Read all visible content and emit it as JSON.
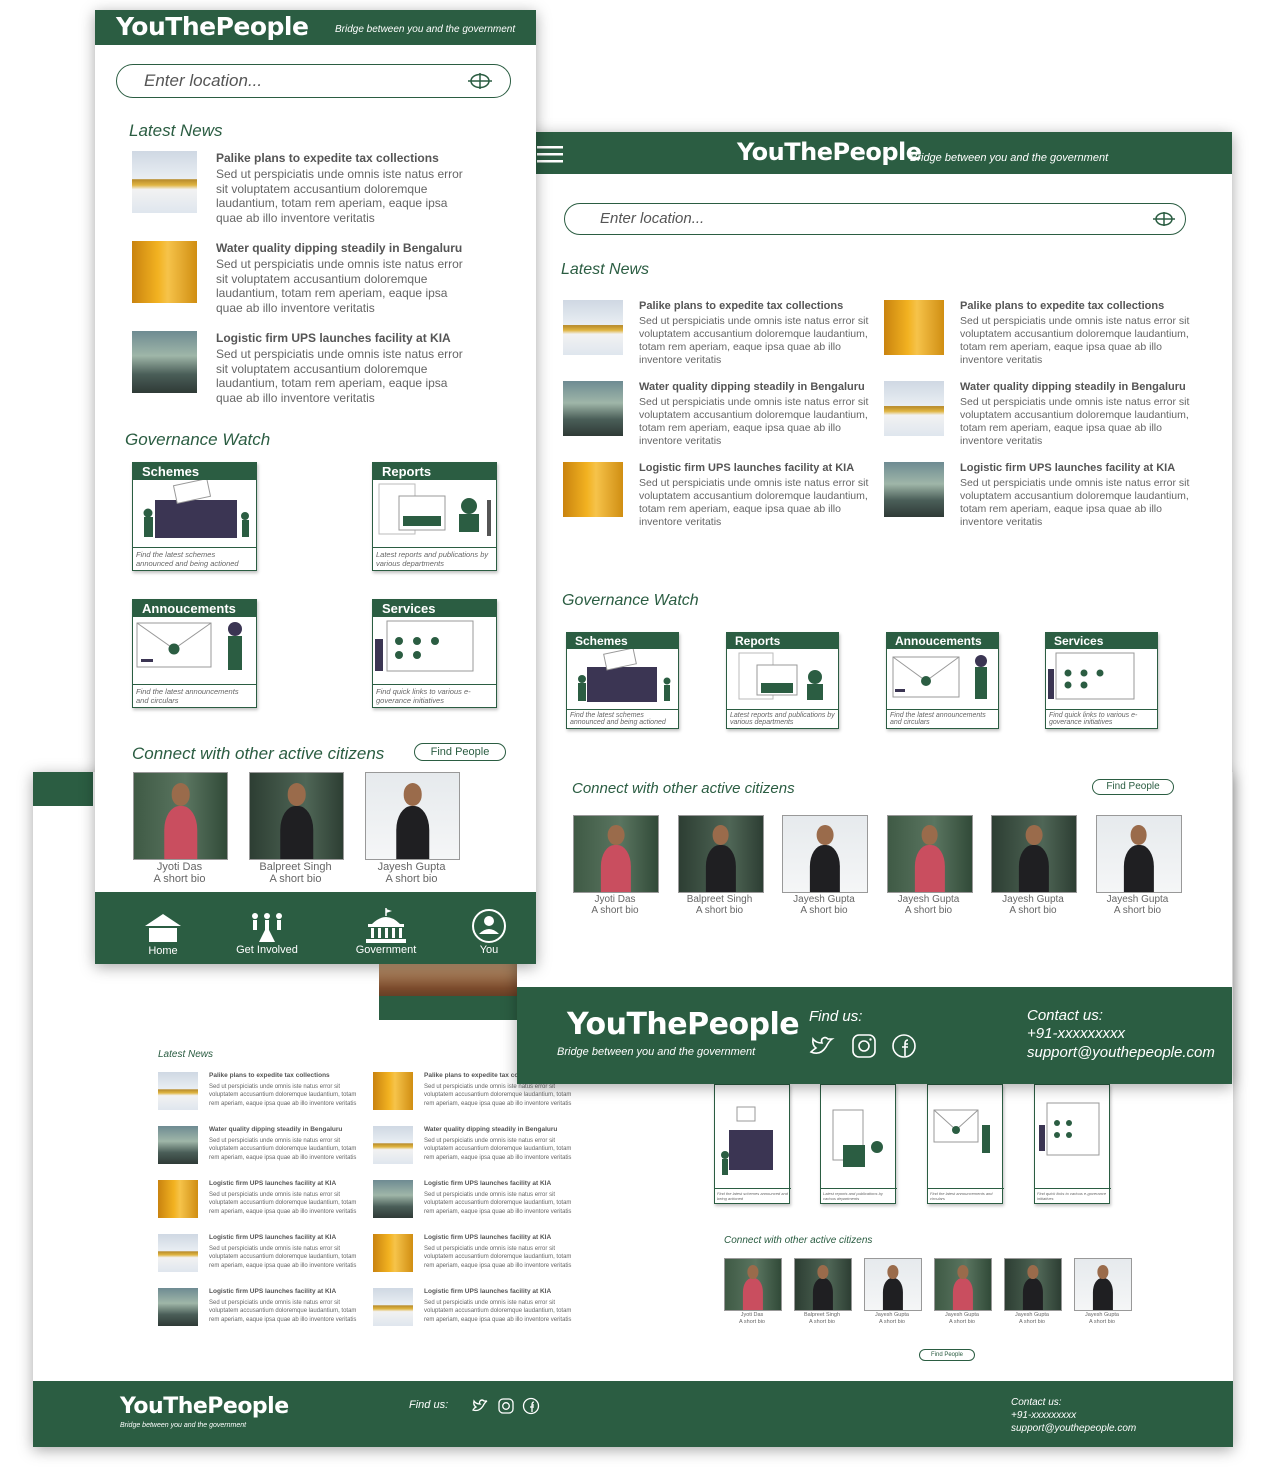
{
  "brand": {
    "name": "YouThePeople",
    "tagline": "Bridge between you and the government"
  },
  "search": {
    "placeholder": "Enter location..."
  },
  "sections": {
    "news": "Latest News",
    "governance": "Governance Watch",
    "connect": "Connect with other active citizens"
  },
  "find_people": "Find People",
  "news": [
    {
      "title": "Palike plans to expedite tax collections",
      "body": "Sed ut perspiciatis unde omnis iste natus error sit voluptatem accusantium doloremque laudantium, totam rem aperiam, eaque ipsa quae ab illo inventore veritatis"
    },
    {
      "title": "Water quality dipping steadily in Bengaluru",
      "body": "Sed ut perspiciatis unde omnis iste natus error sit voluptatem accusantium doloremque laudantium, totam rem aperiam, eaque ipsa quae ab illo inventore veritatis"
    },
    {
      "title": "Logistic firm UPS launches facility at KIA",
      "body": "Sed ut perspiciatis unde omnis iste natus error sit voluptatem accusantium doloremque laudantium, totam rem aperiam, eaque ipsa quae ab illo inventore veritatis"
    }
  ],
  "governance": [
    {
      "title": "Schemes",
      "caption": "Find the latest schemes announced and being actioned"
    },
    {
      "title": "Reports",
      "caption": "Latest reports and publications by various departments"
    },
    {
      "title": "Annoucements",
      "caption": "Find the latest announcements and circulars"
    },
    {
      "title": "Services",
      "caption": "Find quick links to various e-goverance initiatives"
    }
  ],
  "people": [
    {
      "name": "Jyoti Das",
      "bio": "A short bio"
    },
    {
      "name": "Balpreet Singh",
      "bio": "A short bio"
    },
    {
      "name": "Jayesh Gupta",
      "bio": "A short bio"
    },
    {
      "name": "Jayesh Gupta",
      "bio": "A short bio"
    },
    {
      "name": "Jayesh Gupta",
      "bio": "A short bio"
    },
    {
      "name": "Jayesh Gupta",
      "bio": "A short bio"
    }
  ],
  "nav": {
    "home": "Home",
    "involved": "Get Involved",
    "government": "Government",
    "you": "You"
  },
  "footer": {
    "find_us": "Find us:",
    "contact_label": "Contact us:",
    "phone": "+91-xxxxxxxxx",
    "email": "support@youthepeople.com"
  },
  "icons": [
    "hamburger-icon",
    "locate-icon",
    "twitter-icon",
    "instagram-icon",
    "facebook-icon",
    "home-icon",
    "people-icon",
    "government-icon",
    "user-icon"
  ],
  "colors": {
    "brand_green": "#2b5d42"
  }
}
